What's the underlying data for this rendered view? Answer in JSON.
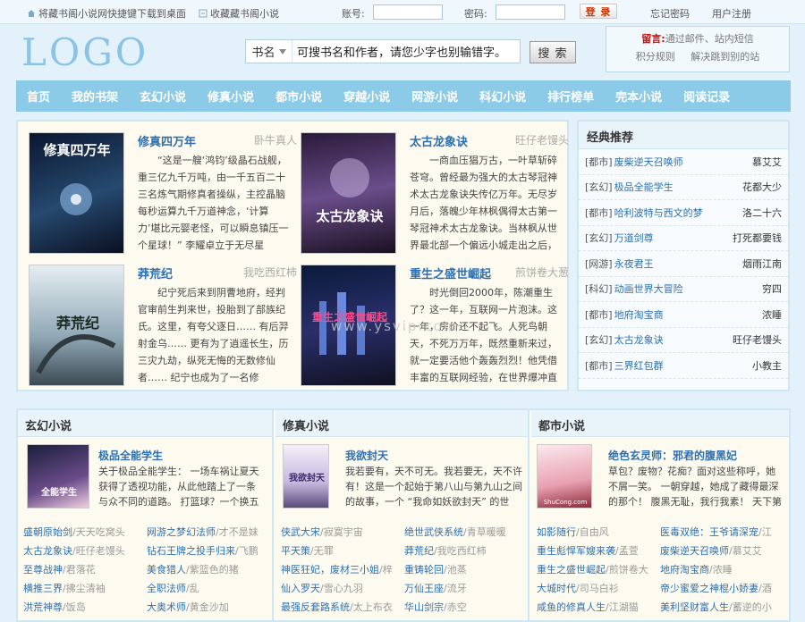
{
  "topbar": {
    "shortcut": "将藏书阁小说网快捷键下载到桌面",
    "favorite": "收藏藏书阁小说",
    "account_label": "账号:",
    "password_label": "密码:",
    "login": "登 录",
    "forgot": "忘记密码",
    "register": "用户注册"
  },
  "header": {
    "logo": "LOGO",
    "search_select": "书名",
    "search_value": "可搜书名和作者，请您少字也别输错字。",
    "search_button": "搜 索",
    "notice_label": "留言:",
    "notice_text": "通过邮件、站内短信",
    "notice_link1": "积分规则",
    "notice_link2": "解决跳到别的站"
  },
  "nav": [
    "首页",
    "我的书架",
    "玄幻小说",
    "修真小说",
    "都市小说",
    "穿越小说",
    "网游小说",
    "科幻小说",
    "排行榜单",
    "完本小说",
    "阅读记录"
  ],
  "featured": [
    {
      "title": "修真四万年",
      "author": "卧牛真人",
      "desc": "“这是一艘‘鸿钧’级晶石战舰，重三亿九千万吨，由一千五百二十三名炼气期修真者操纵，主控晶脑每秒运算九千万道神念，‘计算力’堪比元婴老怪，可以瞬息镇压一个星球！” 李耀卓立于无尽星",
      "cover_text": "修真四万年"
    },
    {
      "title": "太古龙象诀",
      "author": "旺仔老馒头",
      "desc": "一商血压猖万古，一叶草斩碎苍穹。曾经最为强大的太古琴冠神术太古龙象诀失传亿万年。无尽岁月后，落魄少年林枫偶得太古第一琴冠神术太古龙象诀。当林枫从世界最北部一个偏远小城走出之后，",
      "cover_text": "太古龙象诀"
    },
    {
      "title": "莽荒纪",
      "author": "我吃西红柿",
      "desc": "纪宁死后来到阴曹地府，经判官审前生判来世，投胎到了部族纪氏。这里，有夸父逐日…… 有后羿射金乌…… 更有为了逍遥长生，历三灾九劫，纵死无悔的无数修仙者…… 纪宁也成为了一名修",
      "cover_text": "莽荒纪"
    },
    {
      "title": "重生之盛世崛起",
      "author": "煎饼卷大葱",
      "desc": "时光倒回2000年，陈潮重生了？这一年，互联网一片泡沫。这一年，房价还不起飞。人死鸟朝天，不死万万年，既然重新来过，就一定要活他个轰轰烈烈！他凭借丰富的互联网经验，在世界爆冲直",
      "cover_text": "重生之盛世崛起"
    }
  ],
  "watermark": "www.ysvip.com",
  "classic": {
    "title": "经典推荐",
    "items": [
      {
        "cat": "[都市]",
        "title": "废柴逆天召唤师",
        "author": "慕艾艾"
      },
      {
        "cat": "[玄幻]",
        "title": "极品全能学生",
        "author": "花都大少"
      },
      {
        "cat": "[都市]",
        "title": "哈利波特与西文的梦",
        "author": "洛二十六"
      },
      {
        "cat": "[玄幻]",
        "title": "万道剑尊",
        "author": "打死都要钱"
      },
      {
        "cat": "[网游]",
        "title": "永夜君王",
        "author": "烟雨江南"
      },
      {
        "cat": "[科幻]",
        "title": "动画世界大冒险",
        "author": "穷四"
      },
      {
        "cat": "[都市]",
        "title": "地府淘宝商",
        "author": "浓睡"
      },
      {
        "cat": "[玄幻]",
        "title": "太古龙象诀",
        "author": "旺仔老馒头"
      },
      {
        "cat": "[都市]",
        "title": "三界红包群",
        "author": "小教主"
      }
    ]
  },
  "columns": [
    {
      "heading": "玄幻小说",
      "top_title": "极品全能学生",
      "top_desc": "关于极品全能学生： 一场车祸让夏天获得了透视功能，从此他踏上了一条与众不同的道路。 打篮球？一个换五个。 围棋",
      "cover_text": "全能学生",
      "list": [
        [
          "盛朝原始剑",
          "/天天吃窝头"
        ],
        [
          "网游之梦幻法师",
          "/才不是妹"
        ],
        [
          "太古龙象诀",
          "/旺仔老馒头"
        ],
        [
          "钻石王牌之投手归来",
          "/飞鹏"
        ],
        [
          "至尊战神",
          "/君落花"
        ],
        [
          "美食猎人",
          "/紫篮色的猪"
        ],
        [
          "横推三界",
          "/拂尘清袖"
        ],
        [
          "全职法师",
          "/乱"
        ],
        [
          "洪荒神尊",
          "/饭岛"
        ],
        [
          "大奥术师",
          "/黄金沙加"
        ]
      ]
    },
    {
      "heading": "修真小说",
      "top_title": "我欲封天",
      "top_desc": "我若要有，天不可无。我若要无，天不许有！这是一个起始于第八山与第九山之间的故事，一个 “我命如妖欲封天” 的世",
      "cover_text": "我欲封天",
      "list": [
        [
          "侠武大宋",
          "/寂寞宇宙"
        ],
        [
          "绝世武侠系统",
          "/青草暖暖"
        ],
        [
          "平天策",
          "/无罪"
        ],
        [
          "莽荒纪",
          "/我吃西红柿"
        ],
        [
          "神医狂妃，废材三小姐",
          "/梓"
        ],
        [
          "重铸轮回",
          "/池蒸"
        ],
        [
          "仙入罗天",
          "/雪心九羽"
        ],
        [
          "万仙王座",
          "/流牙"
        ],
        [
          "最强反套路系统",
          "/太上布衣"
        ],
        [
          "华山剑宗",
          "/赤空"
        ]
      ]
    },
    {
      "heading": "都市小说",
      "top_title": "绝色玄灵师：邪君的腹黑妃",
      "top_desc": "草包？废物？花痴？面对这些称呼，她不屑一笑。 一朝穿越，她成了藏得最深的那个！ 腹黑无耻，我行我素！ 天下第一杀",
      "cover_text": "ShuCong.com",
      "list": [
        [
          "如影随行",
          "/自由风"
        ],
        [
          "医毒双绝：王爷请深宠",
          "/江"
        ],
        [
          "重生彪悍军嫂来袭",
          "/孟萱"
        ],
        [
          "废柴逆天召唤师",
          "/慕艾艾"
        ],
        [
          "重生之盛世崛起",
          "/煎饼卷大"
        ],
        [
          "地府淘宝商",
          "/浓睡"
        ],
        [
          "大城时代",
          "/司马白衫"
        ],
        [
          "帝少蜜爱之神棍小娇妻",
          "/酒"
        ],
        [
          "咸鱼的修真人生",
          "/江湖猫"
        ],
        [
          "美利坚财富人生",
          "/蓄逆的小"
        ]
      ]
    }
  ]
}
